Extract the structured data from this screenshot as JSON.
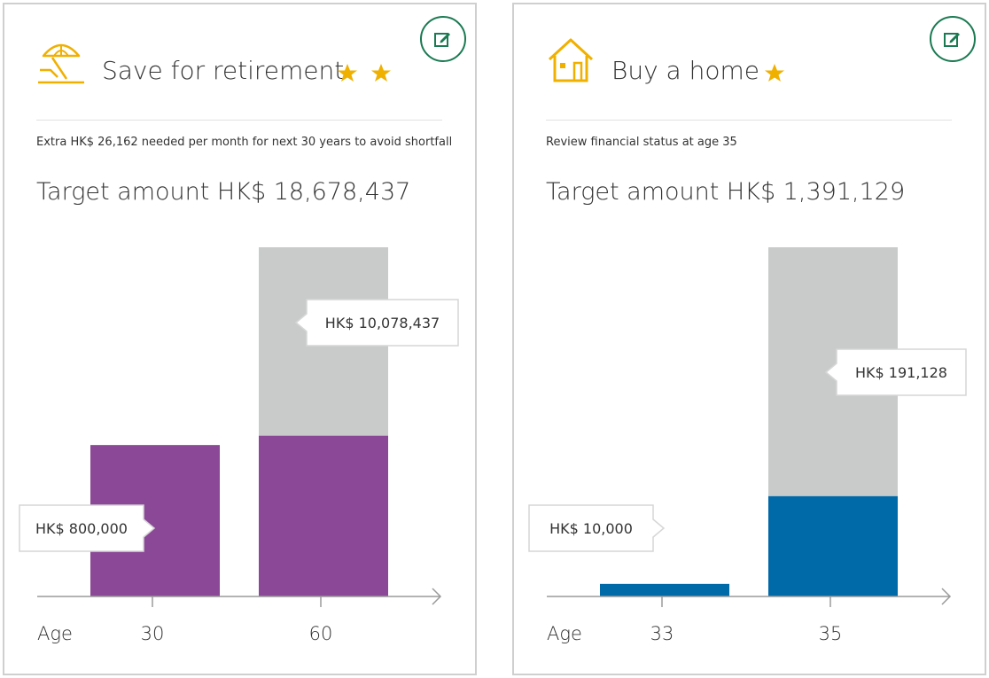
{
  "colors": {
    "edit_green": "#1a7a52",
    "icon_gold": "#f0b000",
    "star_gold": "#f0b000",
    "remaining_gray": "#c9cbcb",
    "retirement_purple": "#8b4897",
    "home_blue": "#0069a8"
  },
  "cards": [
    {
      "icon": "beach-umbrella-icon",
      "title": "Save for retirement",
      "stars": 2,
      "subtitle": "Extra HK$ 26,162 needed per month for next 30 years to avoid shortfall",
      "target": "Target amount HK$ 18,678,437",
      "edit_icon": "edit-icon",
      "chart_data": {
        "type": "bar",
        "stacked": true,
        "xlabel": "Age",
        "categories": [
          "30",
          "60"
        ],
        "ylim": [
          0,
          18678437
        ],
        "series": [
          {
            "values": [
              8100000,
              8600000
            ],
            "color": "#8b4897"
          },
          {
            "values": [
              0,
              10078437
            ],
            "color": "#c9cbcb"
          }
        ],
        "annotations": [
          {
            "category": "30",
            "text": "HK$ 800,000",
            "side": "left"
          },
          {
            "category": "60",
            "text": "HK$ 10,078,437",
            "side": "right"
          }
        ]
      }
    },
    {
      "icon": "house-icon",
      "title": "Buy a home",
      "stars": 1,
      "subtitle": "Review financial status at age 35",
      "target": "Target amount HK$ 1,391,129",
      "edit_icon": "edit-icon",
      "chart_data": {
        "type": "bar",
        "stacked": true,
        "xlabel": "Age",
        "categories": [
          "33",
          "35"
        ],
        "ylim": [
          0,
          1391129
        ],
        "series": [
          {
            "values": [
              50000,
              400000
            ],
            "color": "#0069a8"
          },
          {
            "values": [
              0,
              991129
            ],
            "color": "#c9cbcb"
          }
        ],
        "annotations": [
          {
            "category": "33",
            "text": "HK$ 10,000",
            "side": "left"
          },
          {
            "category": "35",
            "text": "HK$ 191,128",
            "side": "right"
          }
        ]
      }
    }
  ]
}
